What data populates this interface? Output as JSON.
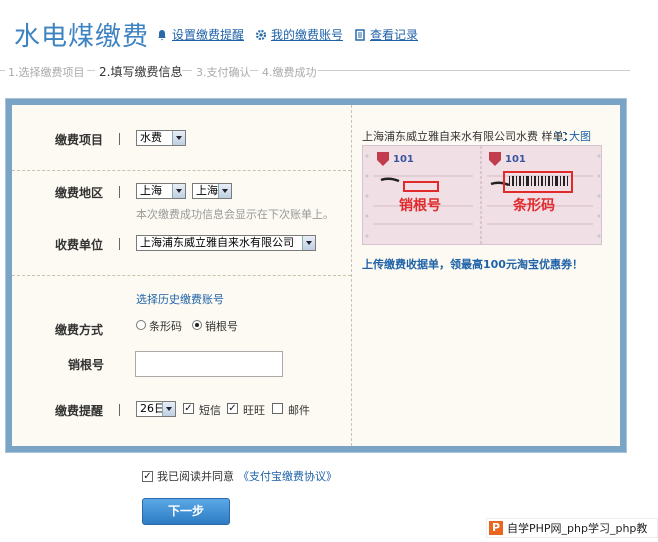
{
  "header": {
    "title": "水电煤缴费",
    "link_reminder": "设置缴费提醒",
    "link_accounts": "我的缴费账号",
    "link_records": "查看记录"
  },
  "steps": [
    "1.选择缴费项目",
    "2.填写缴费信息",
    "3.支付确认",
    "4.缴费成功"
  ],
  "form": {
    "item_label": "缴费项目",
    "item_value": "水费",
    "region_label": "缴费地区",
    "province_value": "上海",
    "city_value": "上海",
    "region_hint": "本次缴费成功信息会显示在下次账单上。",
    "unit_label": "收费单位",
    "unit_value": "上海浦东威立雅自来水有限公司",
    "history_link": "选择历史缴费账号",
    "method_label": "缴费方式",
    "method_barcode": "条形码",
    "method_sales": "销根号",
    "sales_label": "销根号",
    "reminder_label": "缴费提醒",
    "reminder_day": "26日",
    "opt_sms": "短信",
    "opt_wangwang": "旺旺",
    "opt_email": "邮件"
  },
  "sample": {
    "title": "上海浦东威立雅自来水有限公司水费 样单：",
    "enlarge": "大图",
    "label_sales": "销根号",
    "label_barcode": "条形码",
    "promo": "上传缴费收据单，领最高100元淘宝优惠券！"
  },
  "agree": {
    "text": "我已阅读并同意",
    "link": "《支付宝缴费协议》"
  },
  "next_button": "下一步",
  "watermark": {
    "badge": "P",
    "text": "自学PHP网_php学习_php教"
  },
  "colors": {
    "accent": "#3d83c1",
    "link": "#1f62a8",
    "highlight": "#e12b2b"
  }
}
